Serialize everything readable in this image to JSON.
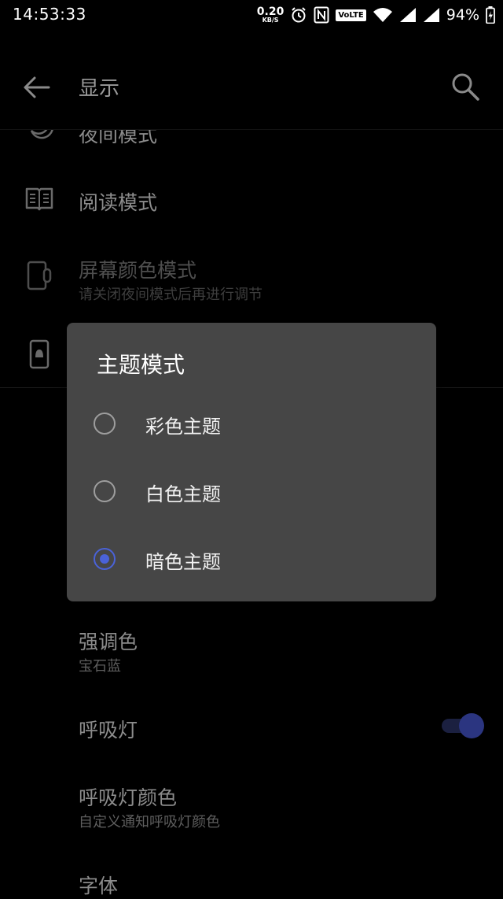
{
  "status_bar": {
    "time": "14:53:33",
    "net_speed_value": "0.20",
    "net_speed_unit": "KB/S",
    "volte": "VoLTE",
    "battery": "94%"
  },
  "header": {
    "title": "显示"
  },
  "settings": {
    "night_mode": {
      "title": "夜间模式"
    },
    "reading_mode": {
      "title": "阅读模式"
    },
    "screen_color_mode": {
      "title": "屏幕颜色模式",
      "subtitle": "请关闭夜间模式后再进行调节"
    },
    "accent_color": {
      "title": "强调色",
      "subtitle": "宝石蓝"
    },
    "breathing_light": {
      "title": "呼吸灯",
      "enabled": true
    },
    "breathing_light_color": {
      "title": "呼吸灯颜色",
      "subtitle": "自定义通知呼吸灯颜色"
    },
    "font": {
      "title": "字体"
    }
  },
  "dialog": {
    "title": "主题模式",
    "options": [
      {
        "label": "彩色主题",
        "selected": false
      },
      {
        "label": "白色主题",
        "selected": false
      },
      {
        "label": "暗色主题",
        "selected": true
      }
    ]
  },
  "colors": {
    "accent": "#4a62d8",
    "dialog_bg": "#464646",
    "background": "#000000"
  }
}
